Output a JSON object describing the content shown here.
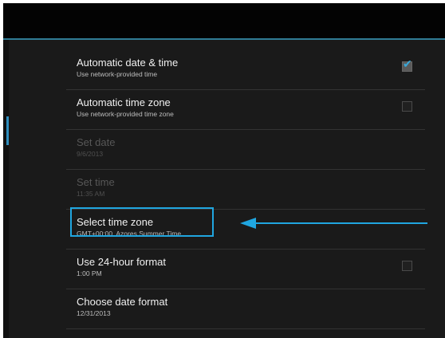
{
  "settings": [
    {
      "title": "Automatic date & time",
      "summary": "Use network-provided time",
      "checkbox": true,
      "checked": true,
      "enabled": true
    },
    {
      "title": "Automatic time zone",
      "summary": "Use network-provided time zone",
      "checkbox": true,
      "checked": false,
      "enabled": true
    },
    {
      "title": "Set date",
      "summary": "9/6/2013",
      "checkbox": false,
      "enabled": false
    },
    {
      "title": "Set time",
      "summary": "11:35 AM",
      "checkbox": false,
      "enabled": false
    },
    {
      "title": "Select time zone",
      "summary": "GMT+00:00, Azores Summer Time",
      "checkbox": false,
      "enabled": true
    },
    {
      "title": "Use 24-hour format",
      "summary": "1:00 PM",
      "checkbox": true,
      "checked": false,
      "enabled": true
    },
    {
      "title": "Choose date format",
      "summary": "12/31/2013",
      "checkbox": false,
      "enabled": true
    }
  ],
  "icons": {
    "checkmark": "checkmark-icon",
    "arrow": "arrow-left-icon"
  },
  "colors": {
    "accent": "#20a6e0",
    "background": "#1a1a1a",
    "action_bar": "#030303"
  }
}
